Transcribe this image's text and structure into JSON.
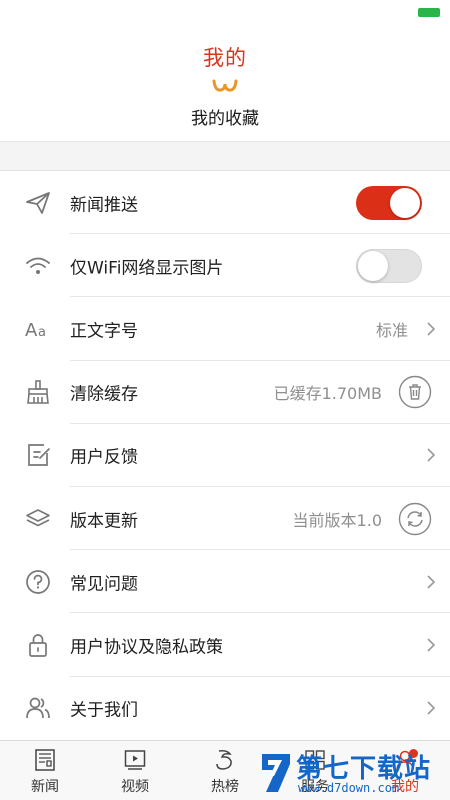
{
  "header": {
    "title": "我的",
    "favorites_label": "我的收藏"
  },
  "settings": [
    {
      "label": "新闻推送",
      "control": "toggle",
      "state": "on"
    },
    {
      "label": "仅WiFi网络显示图片",
      "control": "toggle",
      "state": "off"
    },
    {
      "label": "正文字号",
      "value": "标准",
      "control": "chevron"
    },
    {
      "label": "清除缓存",
      "value": "已缓存1.70MB",
      "control": "trash-button"
    },
    {
      "label": "用户反馈",
      "control": "chevron"
    },
    {
      "label": "版本更新",
      "value": "当前版本1.0",
      "control": "refresh-button"
    },
    {
      "label": "常见问题",
      "control": "chevron"
    },
    {
      "label": "用户协议及隐私政策",
      "control": "chevron"
    },
    {
      "label": "关于我们",
      "control": "chevron"
    }
  ],
  "tabbar": {
    "tabs": [
      {
        "label": "新闻",
        "icon": "newspaper-icon"
      },
      {
        "label": "视频",
        "icon": "video-icon"
      },
      {
        "label": "热榜",
        "icon": "hot-icon"
      },
      {
        "label": "服务",
        "icon": "grid-icon"
      },
      {
        "label": "我的",
        "icon": "profile-icon",
        "active": true
      }
    ]
  },
  "watermark": {
    "title": "第七下载站",
    "url": "www.d7down.com"
  },
  "colors": {
    "accent": "#d9341c",
    "toggle_on": "#dc2f17",
    "watermark": "#1466c8"
  }
}
